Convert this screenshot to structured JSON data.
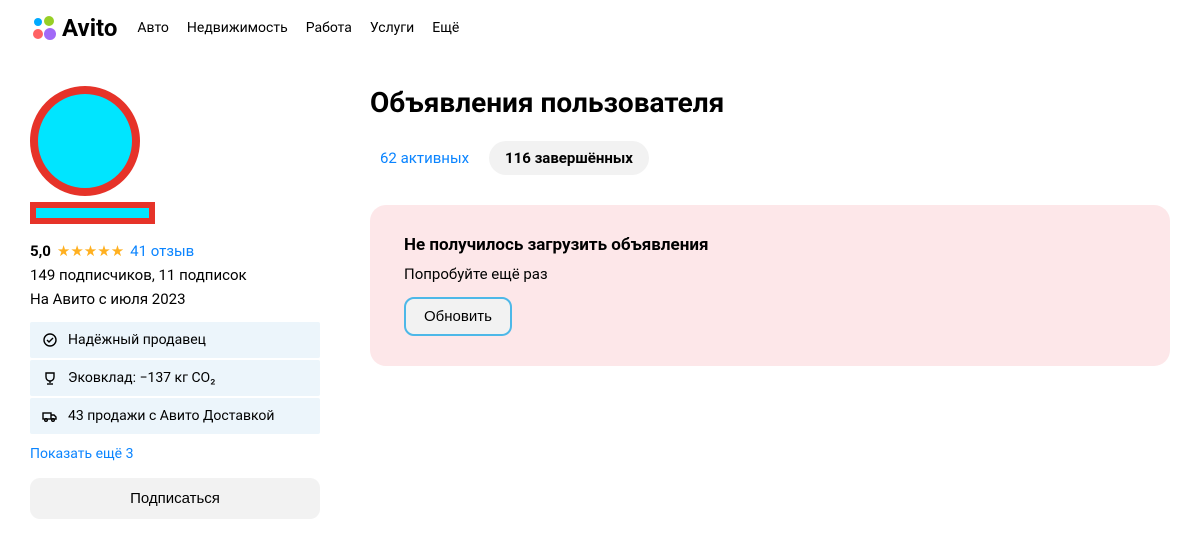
{
  "logo": {
    "text": "Avito"
  },
  "nav": {
    "items": [
      "Авто",
      "Недвижимость",
      "Работа",
      "Услуги",
      "Ещё"
    ]
  },
  "profile": {
    "rating": "5,0",
    "reviews_link": "41 отзыв",
    "subs_line": "149 подписчиков, 11 подписок",
    "since_line": "На Авито с июля 2023"
  },
  "badges": [
    {
      "icon": "check-shield",
      "text": "Надёжный продавец"
    },
    {
      "icon": "trophy",
      "text": "Эковклад: −137 кг CO₂"
    },
    {
      "icon": "truck",
      "text": "43 продажи с Авито Доставкой"
    }
  ],
  "show_more": "Показать ещё 3",
  "subscribe": "Подписаться",
  "main": {
    "title": "Объявления пользователя",
    "tab_active": "62 активных",
    "tab_completed": "116 завершённых"
  },
  "error": {
    "title": "Не получилось загрузить объявления",
    "subtitle": "Попробуйте ещё раз",
    "button": "Обновить"
  }
}
